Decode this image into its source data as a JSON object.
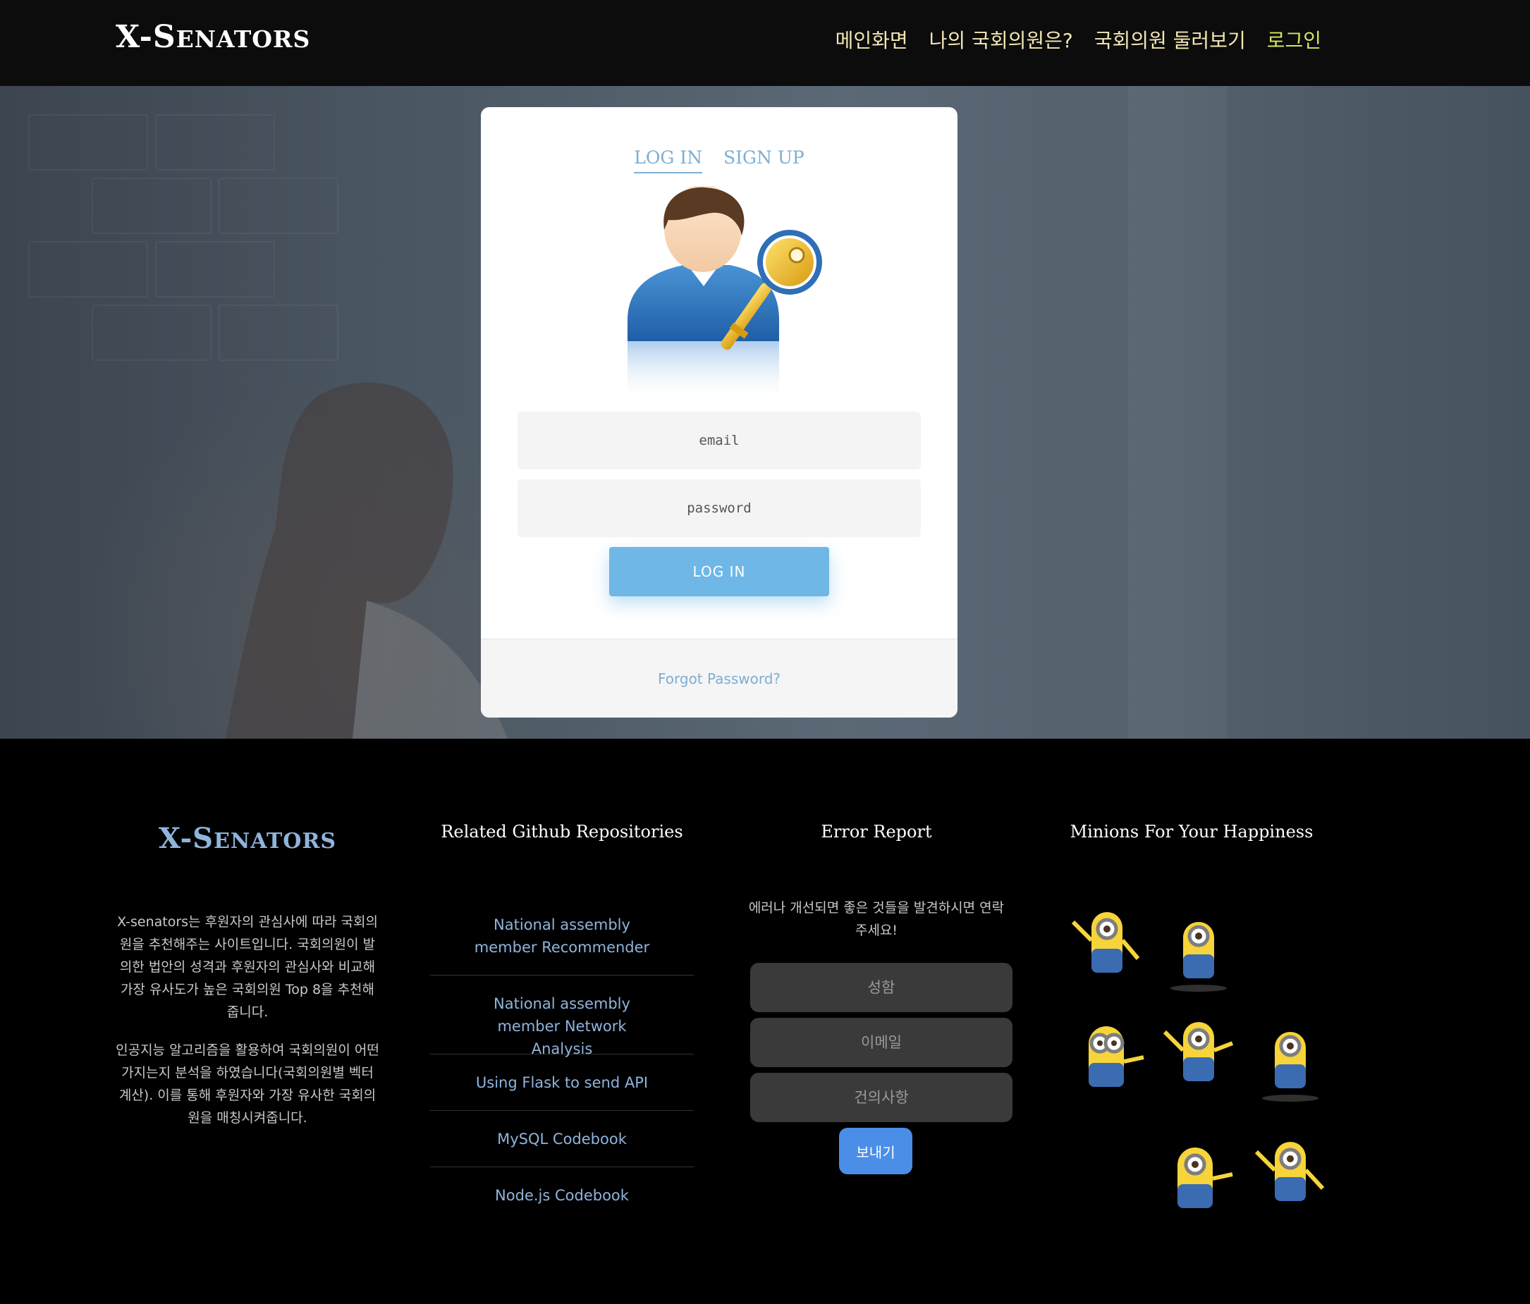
{
  "brand": {
    "initial_x": "X-",
    "initial_s": "S",
    "rest": "ENATORS"
  },
  "nav": {
    "items": [
      {
        "label": "메인화면"
      },
      {
        "label": "나의 국회의원은?"
      },
      {
        "label": "국회의원 둘러보기"
      },
      {
        "label": "로그인"
      }
    ]
  },
  "login": {
    "tab_login": "LOG IN",
    "tab_signup": "SIGN UP",
    "email_placeholder": "email",
    "password_placeholder": "password",
    "button": "LOG IN",
    "forgot": "Forgot Password?",
    "avatar_icon": "user-with-key-icon"
  },
  "footer": {
    "about_paragraph_1": "X-senators는 후원자의 관심사에 따라 국회의원을 추천해주는 사이트입니다. 국회의원이 발의한 법안의 성격과 후원자의 관심사와 비교해 가장 유사도가 높은 국회의원 Top 8을 추천해줍니다.",
    "about_paragraph_2": "인공지능 알고리즘을 활용하여 국회의원이 어떤 가지는지 분석을 하였습니다(국회의원별 벡터 계산). 이를 통해 후원자와 가장 유사한 국회의원을 매칭시켜줍니다.",
    "repos_heading": "Related Github Repositories",
    "repos": [
      {
        "label": "National assembly member Recommender"
      },
      {
        "label": "National assembly member Network Analysis"
      },
      {
        "label": "Using Flask to send API"
      },
      {
        "label": "MySQL Codebook"
      },
      {
        "label": "Node.js Codebook"
      }
    ],
    "error_heading": "Error Report",
    "error_text": "에러나 개선되면 좋은 것들을 발견하시면 연락주세요!",
    "name_placeholder": "성함",
    "email_placeholder": "이메일",
    "message_placeholder": "건의사항",
    "send_button": "보내기",
    "minions_heading": "Minions For Your Happiness",
    "minion_icon": "minion-image"
  },
  "colors": {
    "nav_text": "#f3e7b3",
    "nav_active": "#d8e65f",
    "accent_blue": "#6fb7e6",
    "link_blue": "#8fb4dc",
    "send_blue": "#4a8ee8"
  }
}
